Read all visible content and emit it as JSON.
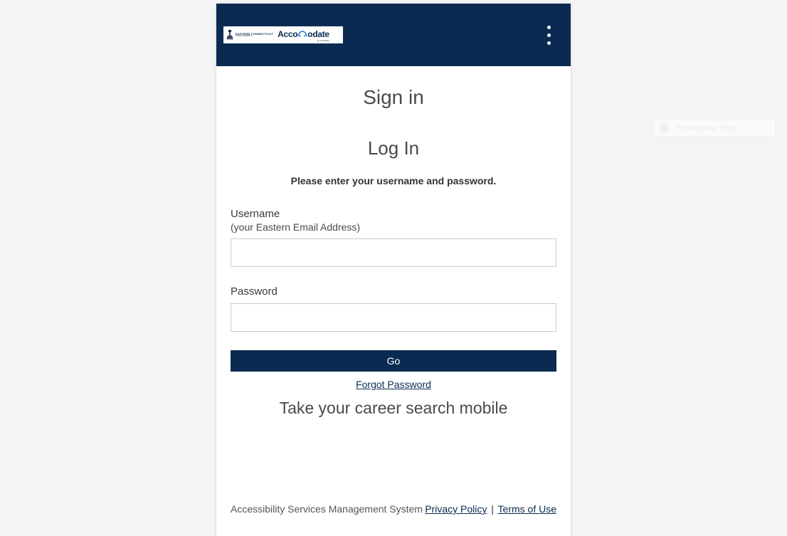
{
  "brand": {
    "logo_left_line1": "EASTERN CONNECTICUT",
    "logo_left_line2": "STATE UNIVERSITY",
    "logo_right_pre": "Acco",
    "logo_right_accent": "m",
    "logo_right_post": "odate",
    "logo_right_sub": "by symplicity"
  },
  "header": {
    "signin": "Sign in",
    "login": "Log In",
    "instruction": "Please enter your username and password."
  },
  "form": {
    "username_label": "Username",
    "username_sub": "(your Eastern Email Address)",
    "username_value": "",
    "password_label": "Password",
    "password_value": "",
    "go_label": "Go",
    "forgot_label": "Forgot Password"
  },
  "promo": {
    "mobile": "Take your career search mobile"
  },
  "footer": {
    "system": "Accessibility Services Management System",
    "privacy": "Privacy Policy",
    "sep": "|",
    "terms": "Terms of Use"
  },
  "ghost": {
    "text": "Rectangular Snip"
  }
}
